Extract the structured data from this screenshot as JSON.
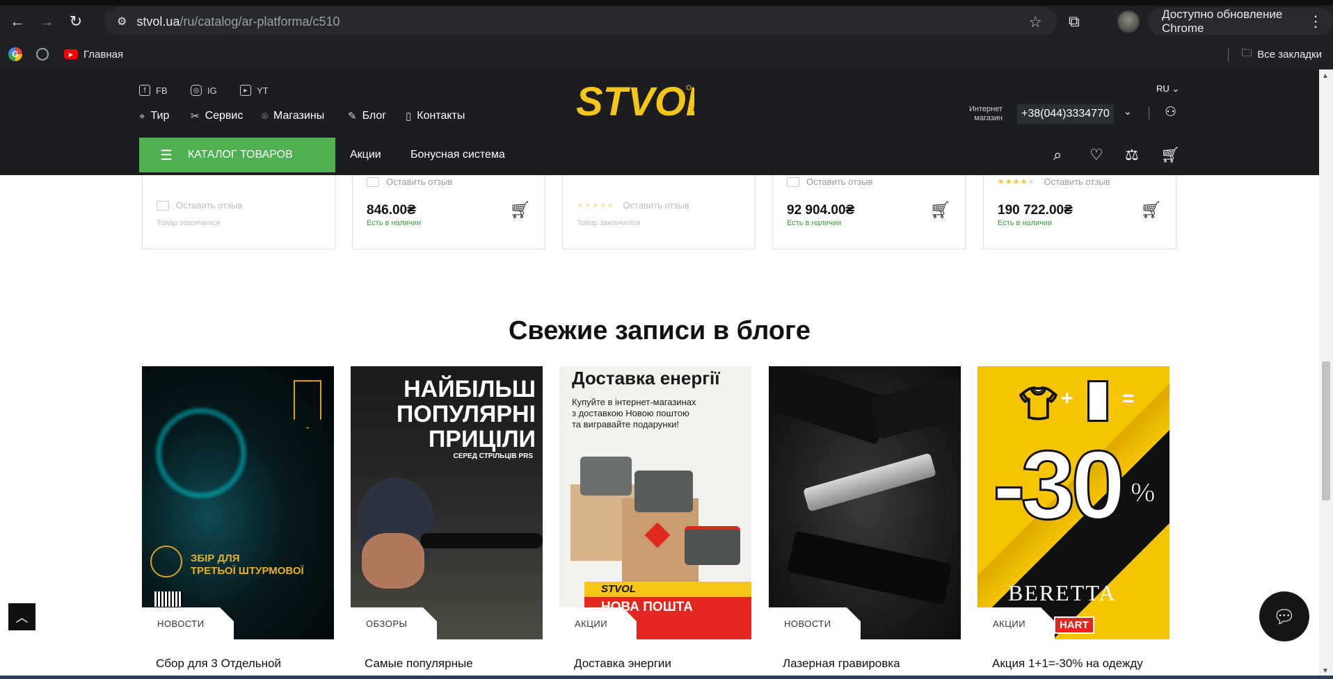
{
  "browser": {
    "url_site": "stvol.ua",
    "url_path": "/ru/catalog/ar-platforma/c510",
    "update_label": "Доступно обновление Chrome",
    "bookmarks": [
      {
        "label": "Главная"
      }
    ],
    "all_bookmarks": "Все закладки"
  },
  "header": {
    "social": [
      "FB",
      "IG",
      "YT"
    ],
    "nav": [
      "Тир",
      "Сервис",
      "Магазины",
      "Блог",
      "Контакты"
    ],
    "logo_text": "STVOL",
    "lang": "RU",
    "shop_label_1": "Интернет",
    "shop_label_2": "магазин",
    "phone": "+38(044)3334770",
    "catalog_label": "КАТАЛОГ ТОВАРОВ",
    "menu": [
      "Акции",
      "Бонусная система"
    ],
    "colors": {
      "background": "#1b1d20",
      "accent": "#4caf50",
      "logo": "#f5c518"
    }
  },
  "products": [
    {
      "review": "Оставить отзыв",
      "rating": 0,
      "price": "",
      "status": "Товар закончился",
      "in_stock": false
    },
    {
      "review": "Оставить отзыв",
      "rating": 0,
      "price": "846.00₴",
      "status": "Есть в наличии",
      "in_stock": true
    },
    {
      "review": "Оставить отзыв",
      "rating": 5,
      "price": "",
      "status": "Товар закончился",
      "in_stock": false
    },
    {
      "review": "Оставить отзыв",
      "rating": 0,
      "price": "92 904.00₴",
      "status": "Есть в наличии",
      "in_stock": true
    },
    {
      "review": "Оставить отзыв",
      "rating": 4,
      "price": "190 722.00₴",
      "status": "Есть в наличии",
      "in_stock": true
    }
  ],
  "blog": {
    "title": "Свежие записи в блоге",
    "posts": [
      {
        "tag": "НОВОСТИ",
        "title": "Сбор для 3 Отдельной",
        "poster_text_1": "ЗБІР ДЛЯ",
        "poster_text_2": "ТРЕТЬОЇ ШТУРМОВОЇ"
      },
      {
        "tag": "ОБЗОРЫ",
        "title": "Самые популярные",
        "poster_text_1": "НАЙБІЛЬШ",
        "poster_text_2": "ПОПУЛЯРНІ",
        "poster_text_3": "ПРИЦІЛИ",
        "poster_text_4": "СЕРЕД СТРІЛЬЦІВ PRS"
      },
      {
        "tag": "АКЦИИ",
        "title": "Доставка энергии",
        "poster_text_1": "Доставка енергії",
        "poster_text_2": "Купуйте в інтернет-магазинах",
        "poster_text_3": "з доставкою Новою поштою",
        "poster_text_4": "та вигравайте подарунки!",
        "poster_text_5": "STVOL",
        "poster_text_6": "НОВА ПОШТА"
      },
      {
        "tag": "НОВОСТИ",
        "title": "Лазерная гравировка"
      },
      {
        "tag": "АКЦИИ",
        "title": "Акция 1+1=-30% на одежду",
        "poster_text_1": "-30",
        "poster_text_2": "%",
        "poster_text_3": "BERETTA",
        "poster_text_4": "HART"
      }
    ]
  }
}
